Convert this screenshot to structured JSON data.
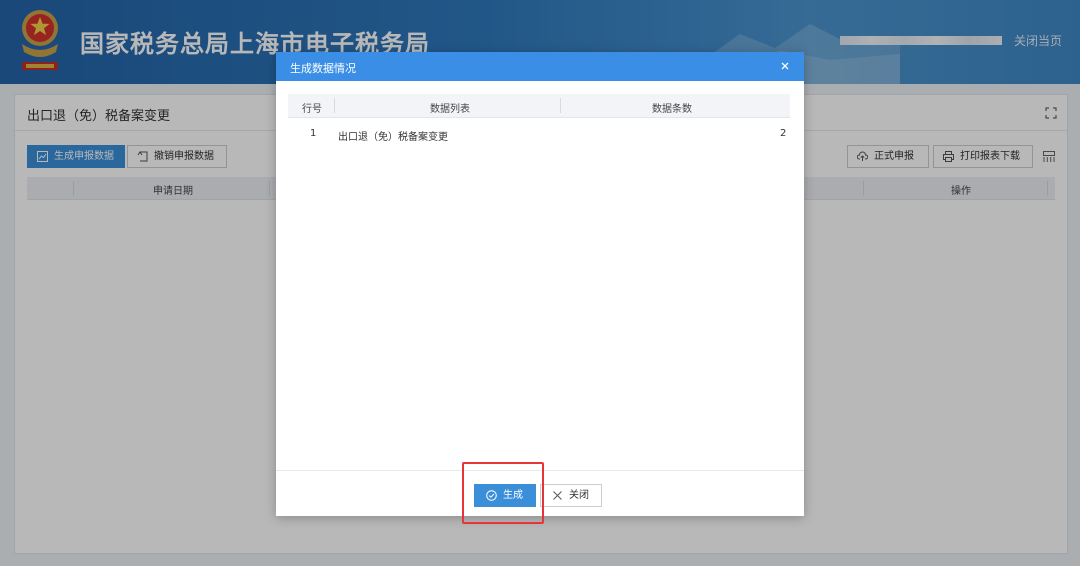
{
  "header": {
    "site_title": "国家税务总局上海市电子税务局",
    "close_page": "关闭当页"
  },
  "panel": {
    "title": "出口退（免）税备案变更",
    "toolbar": {
      "generate_label": "生成申报数据",
      "revoke_label": "撤销申报数据",
      "submit_label": "正式申报",
      "print_label": "打印报表下载"
    },
    "table": {
      "columns": [
        "申请日期",
        "操作"
      ]
    }
  },
  "modal": {
    "title": "生成数据情况",
    "columns": [
      "行号",
      "数据列表",
      "数据条数"
    ],
    "rows": [
      {
        "index": "1",
        "name": "出口退（免）税备案变更",
        "count": "2"
      }
    ],
    "generate_label": "生成",
    "close_label": "关闭"
  },
  "colors": {
    "header_blue": "#2f79bd",
    "primary": "#3b8fd9",
    "modal_header": "#3a8ee6",
    "highlight": "#e5343a"
  }
}
